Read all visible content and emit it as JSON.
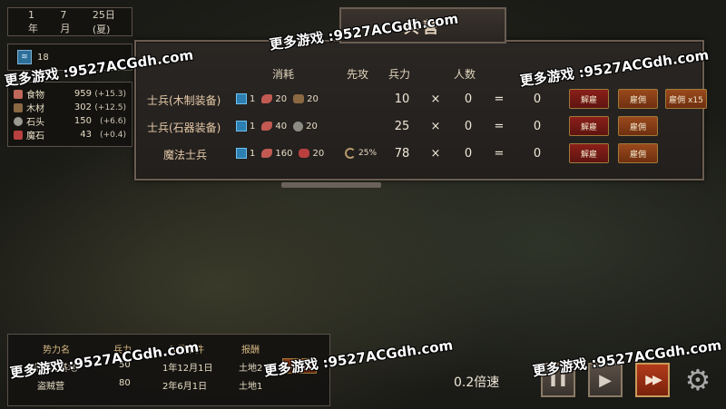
{
  "date": {
    "year": "1年",
    "month": "7月",
    "day": "25日(夏)"
  },
  "population": {
    "icon_text": "≋",
    "value": "18"
  },
  "resources": [
    {
      "icon": "food-icon",
      "color": "#c0685a",
      "name": "食物",
      "value": "959",
      "rate": "(+15.3)"
    },
    {
      "icon": "wood-icon",
      "color": "#8a6842",
      "name": "木材",
      "value": "302",
      "rate": "(+12.5)"
    },
    {
      "icon": "stone-icon",
      "color": "#9a9a92",
      "name": "石头",
      "value": "150",
      "rate": "(+6.6)"
    },
    {
      "icon": "magic-stone-icon",
      "color": "#b8403e",
      "name": "魔石",
      "value": "43",
      "rate": "(+0.4)"
    }
  ],
  "barracks": {
    "title": "兵营",
    "headers": {
      "cost": "消耗",
      "first_strike": "先攻",
      "power": "兵力",
      "count": "人数"
    },
    "times": "×",
    "equals": "=",
    "units": [
      {
        "name": "士兵(木制装备)",
        "costs": [
          {
            "icon": "scroll-icon",
            "value": "1"
          },
          {
            "icon": "meat-icon",
            "value": "20"
          },
          {
            "icon": "wood-icon",
            "value": "20"
          }
        ],
        "first_strike": "",
        "power": "10",
        "count": "0",
        "total": "0",
        "buttons": [
          "解雇",
          "雇佣",
          "雇佣 x15"
        ]
      },
      {
        "name": "士兵(石器装备)",
        "costs": [
          {
            "icon": "scroll-icon",
            "value": "1"
          },
          {
            "icon": "meat-icon",
            "value": "40"
          },
          {
            "icon": "stone-icon",
            "value": "20"
          }
        ],
        "first_strike": "",
        "power": "25",
        "count": "0",
        "total": "0",
        "buttons": [
          "解雇",
          "雇佣"
        ]
      },
      {
        "name": "魔法士兵",
        "costs": [
          {
            "icon": "scroll-icon",
            "value": "1"
          },
          {
            "icon": "meat-icon",
            "value": "160"
          },
          {
            "icon": "crystal-icon",
            "value": "20"
          }
        ],
        "first_strike": "25%",
        "power": "78",
        "count": "0",
        "total": "0",
        "buttons": [
          "解雇",
          "雇佣"
        ]
      }
    ]
  },
  "factions": {
    "headers": {
      "name": "势力名",
      "power": "兵力",
      "event": "入侵事件",
      "reward": "报酬"
    },
    "rows": [
      {
        "name": "盗贼团基地",
        "power": "50",
        "event": "1年12月1日",
        "reward": "土地2",
        "action": "攻击"
      },
      {
        "name": "盗贼营",
        "power": "80",
        "event": "2年6月1日",
        "reward": "土地1",
        "action": ""
      }
    ]
  },
  "speed": {
    "label": "0.2倍速",
    "pause": "❚❚",
    "play": "▶",
    "fast": "▶▶"
  },
  "watermark": "更多游戏 :9527ACGdh.com"
}
